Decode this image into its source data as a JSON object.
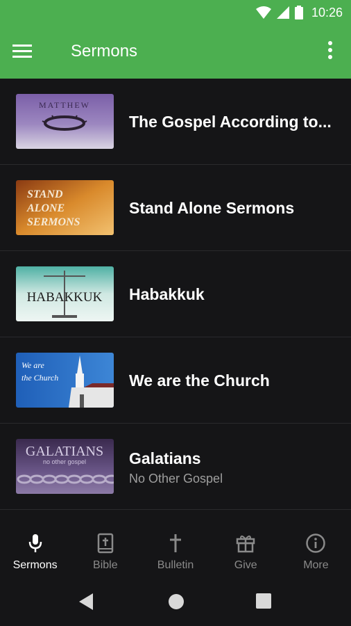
{
  "status": {
    "time": "10:26"
  },
  "appbar": {
    "title": "Sermons"
  },
  "sermons": [
    {
      "title": "The Gospel According to...",
      "subtitle": "",
      "thumb_text": "MATTHEW"
    },
    {
      "title": "Stand Alone Sermons",
      "subtitle": "",
      "thumb_text": "STAND ALONE SERMONS"
    },
    {
      "title": "Habakkuk",
      "subtitle": "",
      "thumb_text": "HABAKKUK"
    },
    {
      "title": "We are the Church",
      "subtitle": "",
      "thumb_text": "We are the Church"
    },
    {
      "title": "Galatians",
      "subtitle": "No Other Gospel",
      "thumb_text": "GALATIANS",
      "thumb_sub": "no other gospel"
    }
  ],
  "bottom_nav": {
    "items": [
      {
        "label": "Sermons",
        "icon": "microphone-icon",
        "active": true
      },
      {
        "label": "Bible",
        "icon": "bible-icon",
        "active": false
      },
      {
        "label": "Bulletin",
        "icon": "cross-icon",
        "active": false
      },
      {
        "label": "Give",
        "icon": "gift-icon",
        "active": false
      },
      {
        "label": "More",
        "icon": "info-icon",
        "active": false
      }
    ]
  },
  "colors": {
    "accent": "#4caf50",
    "background": "#151517",
    "inactive": "#8a8a8a"
  }
}
